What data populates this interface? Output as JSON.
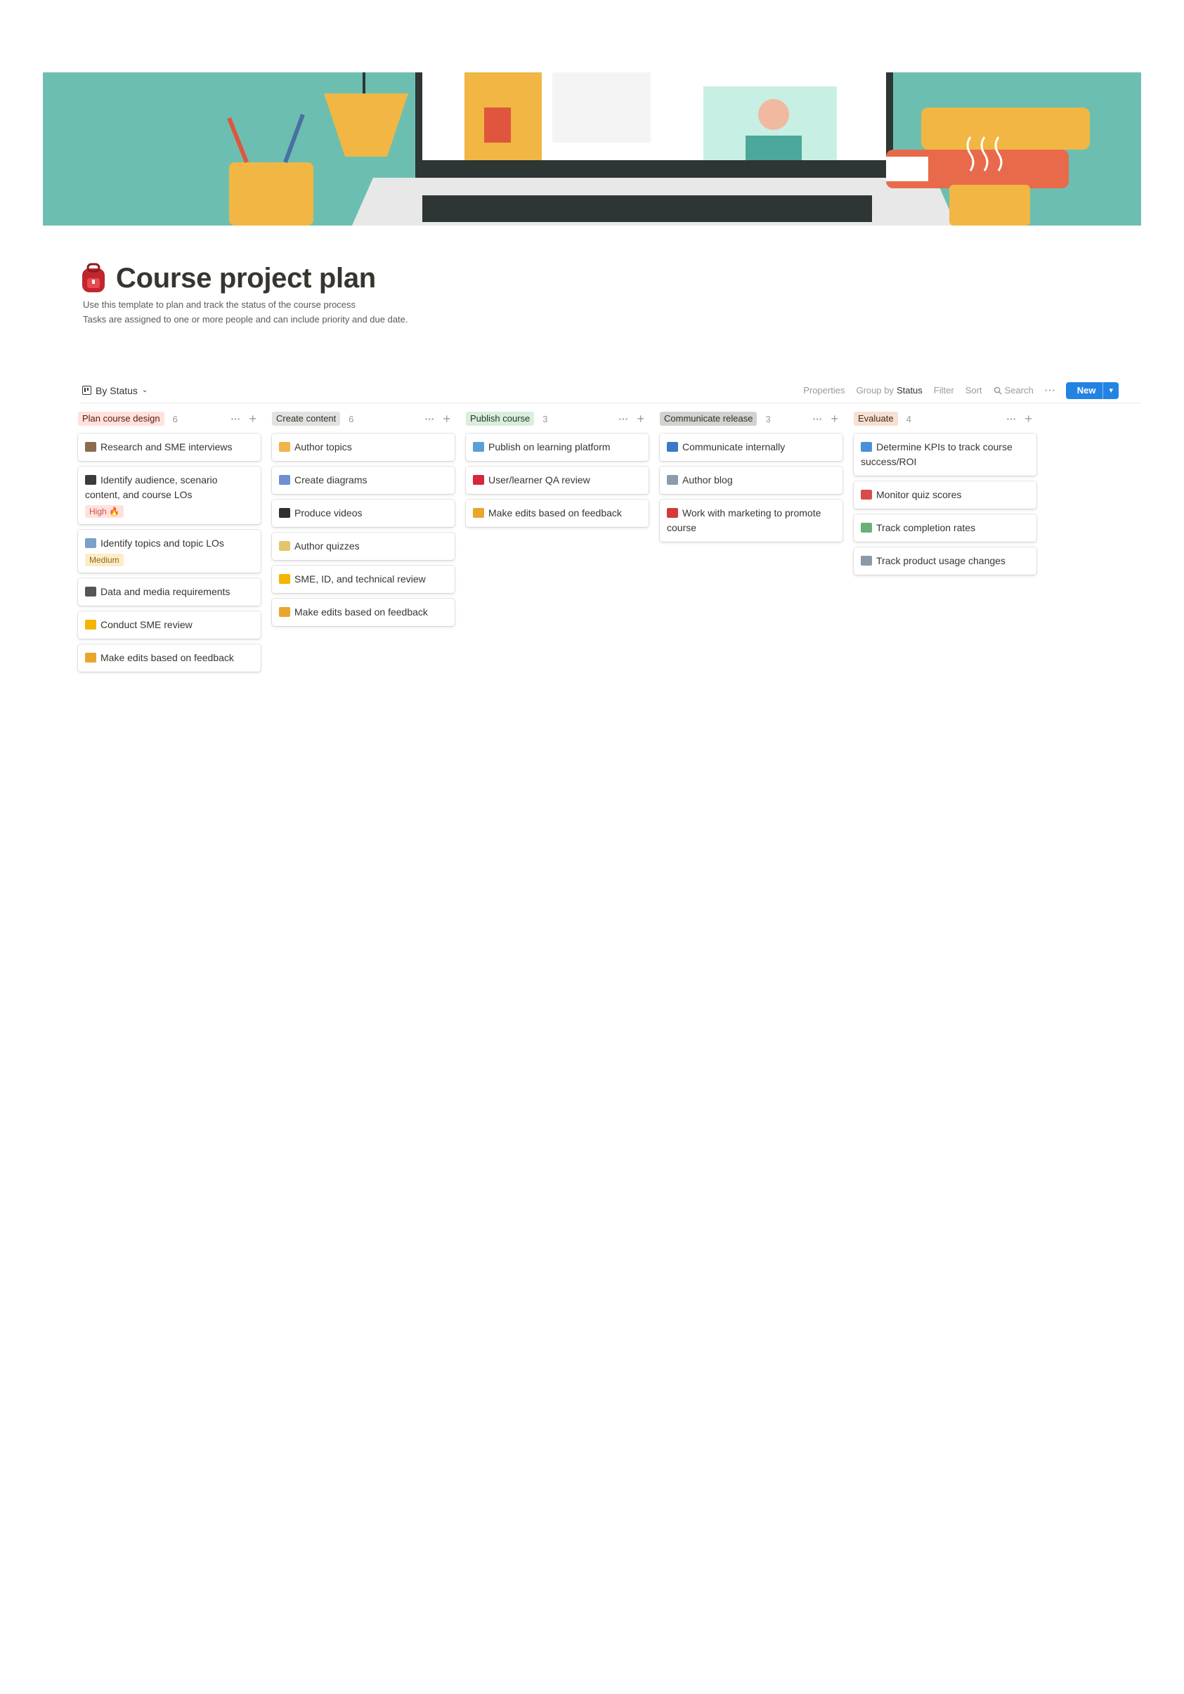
{
  "page": {
    "title": "Course project plan",
    "icon": "backpack-icon",
    "description_line1": "Use this template to plan and track the status of the course process",
    "description_line2": "Tasks are assigned to one or more people and can include priority and due date."
  },
  "viewbar": {
    "view_label": "By Status",
    "properties": "Properties",
    "group_by_prefix": "Group by",
    "group_by_value": "Status",
    "filter": "Filter",
    "sort": "Sort",
    "search": "Search",
    "more": "···",
    "new_label": "New"
  },
  "columns": [
    {
      "label": "Plan course design",
      "count": "6",
      "pill_bg": "#ffe2dd",
      "pill_fg": "#5d1715",
      "cards": [
        {
          "title": "Research and SME interviews",
          "emoji": "books-icon",
          "emoji_color": "#8a6d4f"
        },
        {
          "title": "Identify audience, scenario content, and course LOs",
          "emoji": "person-icon",
          "emoji_color": "#3c3c3c",
          "tag": "High 🔥",
          "tag_bg": "#ffe2dd",
          "tag_fg": "#d44c47"
        },
        {
          "title": "Identify topics and topic LOs",
          "emoji": "magnifier-icon",
          "emoji_color": "#7aa1c8",
          "tag": "Medium",
          "tag_bg": "#fdecc8",
          "tag_fg": "#8c6a1a"
        },
        {
          "title": "Data and media requirements",
          "emoji": "projector-icon",
          "emoji_color": "#555555"
        },
        {
          "title": "Conduct SME review",
          "emoji": "nerd-face-icon",
          "emoji_color": "#f4b400"
        },
        {
          "title": "Make edits based on feedback",
          "emoji": "notebook-icon",
          "emoji_color": "#e8a72c"
        }
      ]
    },
    {
      "label": "Create content",
      "count": "6",
      "pill_bg": "#e3e2e0",
      "pill_fg": "#32302c",
      "cards": [
        {
          "title": "Author topics",
          "emoji": "writing-hand-icon",
          "emoji_color": "#f1b34a"
        },
        {
          "title": "Create diagrams",
          "emoji": "bar-chart-icon",
          "emoji_color": "#6f8fcf"
        },
        {
          "title": "Produce videos",
          "emoji": "clapper-icon",
          "emoji_color": "#2f2f2f"
        },
        {
          "title": "Author quizzes",
          "emoji": "memo-icon",
          "emoji_color": "#e5c46a"
        },
        {
          "title": "SME, ID, and technical review",
          "emoji": "nerd-face-icon",
          "emoji_color": "#f4b400"
        },
        {
          "title": "Make edits based on feedback",
          "emoji": "notebook-icon",
          "emoji_color": "#e8a72c"
        }
      ]
    },
    {
      "label": "Publish course",
      "count": "3",
      "pill_bg": "#dbeddb",
      "pill_fg": "#1c3829",
      "cards": [
        {
          "title": "Publish on learning platform",
          "emoji": "computer-icon",
          "emoji_color": "#5aa0d8"
        },
        {
          "title": "User/learner QA review",
          "emoji": "question-mark-icon",
          "emoji_color": "#d7263d"
        },
        {
          "title": "Make edits based on feedback",
          "emoji": "notebook-icon",
          "emoji_color": "#e8a72c"
        }
      ]
    },
    {
      "label": "Communicate release",
      "count": "3",
      "pill_bg": "#d3d2cf",
      "pill_fg": "#32302c",
      "cards": [
        {
          "title": "Communicate internally",
          "emoji": "megaphone-icon",
          "emoji_color": "#3c78c8"
        },
        {
          "title": "Author blog",
          "emoji": "newspaper-icon",
          "emoji_color": "#8a9bb0"
        },
        {
          "title": "Work with marketing to promote course",
          "emoji": "siren-icon",
          "emoji_color": "#d23a3a"
        }
      ]
    },
    {
      "label": "Evaluate",
      "count": "4",
      "pill_bg": "#f5e0d3",
      "pill_fg": "#49290e",
      "cards": [
        {
          "title": "Determine KPIs to track course success/ROI",
          "emoji": "diamond-icon",
          "emoji_color": "#4a90d9"
        },
        {
          "title": "Monitor quiz scores",
          "emoji": "chart-up-icon",
          "emoji_color": "#d84c4c"
        },
        {
          "title": "Track completion rates",
          "emoji": "picture-icon",
          "emoji_color": "#6bb07a"
        },
        {
          "title": "Track product usage changes",
          "emoji": "jar-icon",
          "emoji_color": "#8a9aa8"
        }
      ]
    }
  ]
}
